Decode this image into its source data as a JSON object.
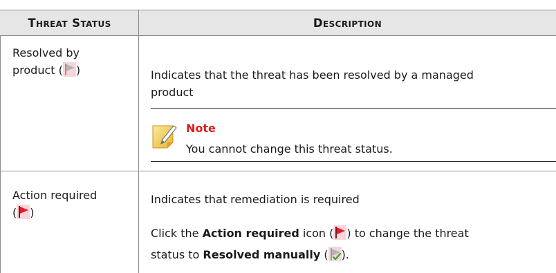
{
  "header": {
    "col1": "Threat Status",
    "col2": "Description"
  },
  "rows": [
    {
      "status_line1": "Resolved by",
      "status_line2_pre": "product (",
      "status_line2_post": ")",
      "status_icon": "gray-flag-icon",
      "description": "Indicates that the threat has been resolved by a managed",
      "description_cont": "product",
      "note": {
        "title": "Note",
        "text": "You cannot change this threat status.",
        "icon": "note-pencil-icon"
      }
    },
    {
      "status_line1": "Action required",
      "status_line2_pre": "(",
      "status_line2_post": ")",
      "status_icon": "red-flag-icon",
      "description": "Indicates that remediation is required",
      "instr_pre": "Click the ",
      "instr_bold1": "Action required",
      "instr_mid": " icon (",
      "instr_after_icon": ") to change the threat",
      "instr_line2_pre": "status to ",
      "instr_bold2": "Resolved manually",
      "instr_line2_mid": " (",
      "instr_line2_post": ").",
      "instr_icon1": "red-flag-icon",
      "instr_icon2": "gray-check-flag-icon"
    }
  ],
  "colors": {
    "header_bg": "#e6e6e6",
    "border": "#8a8a8a",
    "note_title": "#e31b1b",
    "flag_red": "#e8192c",
    "flag_gray": "#b3b3b3",
    "icon_bg": "#f6d6da",
    "check_green": "#2aa52a"
  }
}
